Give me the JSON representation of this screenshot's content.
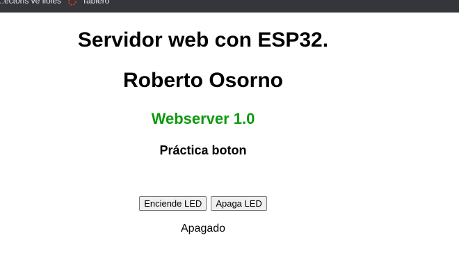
{
  "bookmarks_bar": {
    "items": [
      {
        "label": "...ectoris ve lloles",
        "icon": ""
      },
      {
        "label": "Tablero",
        "icon": "dashboard-icon"
      }
    ]
  },
  "page": {
    "title": "Servidor web con ESP32.",
    "author": "Roberto Osorno",
    "version": "Webserver 1.0",
    "subtitle": "Práctica boton",
    "buttons": {
      "on_label": "Enciende LED",
      "off_label": "Apaga LED"
    },
    "status": "Apagado"
  },
  "colors": {
    "version_text": "#0d9a0d",
    "bookmarks_bar_bg": "#35363a"
  }
}
